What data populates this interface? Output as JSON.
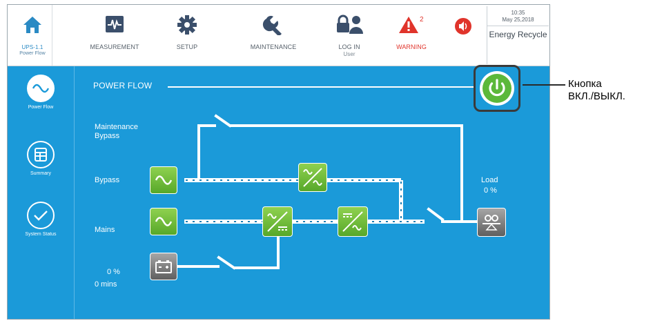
{
  "topbar": {
    "home": {
      "label": "UPS-1.1",
      "sub": "Power Flow",
      "icon": "home-icon"
    },
    "measurement": {
      "label": "MEASUREMENT",
      "icon": "pulse-icon"
    },
    "setup": {
      "label": "SETUP",
      "icon": "gear-icon"
    },
    "maintenance": {
      "label": "MAINTENANCE",
      "icon": "wrench-icon"
    },
    "login": {
      "label": "LOG IN",
      "sub": "User",
      "icon": "lock-user-icon"
    },
    "warning": {
      "label": "WARNING",
      "count": "2",
      "icon": "warning-icon"
    },
    "mute": {
      "icon": "speaker-icon"
    },
    "clock": {
      "time": "10:35",
      "date": "May 25,2018",
      "energy": "Energy Recycle"
    }
  },
  "sidebar": {
    "items": [
      {
        "label": "Power Flow",
        "icon": "sine-icon"
      },
      {
        "label": "Summary",
        "icon": "summary-icon"
      },
      {
        "label": "System Status",
        "icon": "check-icon"
      }
    ]
  },
  "power_flow": {
    "title": "POWER FLOW",
    "rows": {
      "maintenance_bypass": "Maintenance\nBypass",
      "bypass": "Bypass",
      "mains": "Mains"
    },
    "battery": {
      "percent": "0 %",
      "mins": "0 mins"
    },
    "load": {
      "label": "Load",
      "percent": "0 %"
    }
  },
  "callout": {
    "text": "Кнопка\nВКЛ./ВЫКЛ."
  },
  "colors": {
    "accent": "#1b9ad9",
    "green": "#6cbf3a",
    "warning": "#e0342b",
    "power": "#5cb83a"
  }
}
